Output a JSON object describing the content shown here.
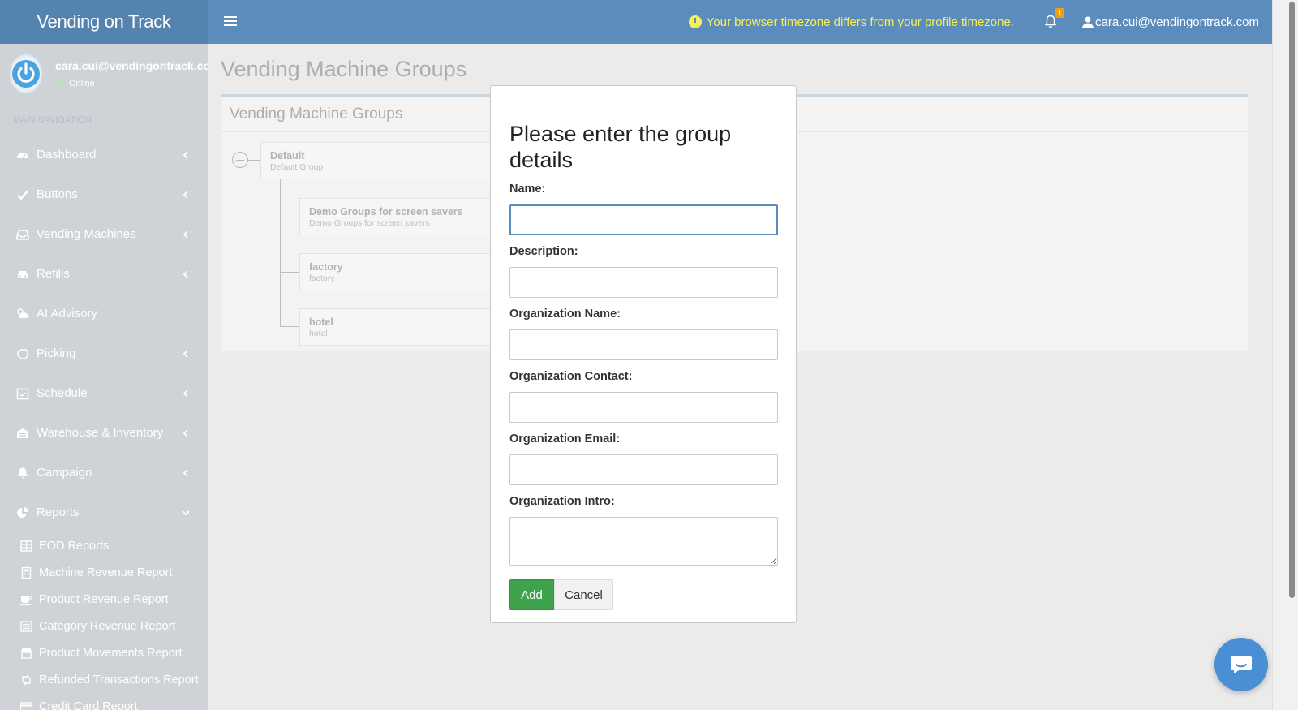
{
  "app": {
    "brand": "Vending on Track",
    "timezone_warning": "Your browser timezone differs from your profile timezone.",
    "notification_count": "1",
    "user_email": "cara.cui@vendingontrack.com"
  },
  "sidebar": {
    "user_email": "cara.cui@vendingontrack.com",
    "status": "Online",
    "nav_header": "MAIN NAVIGATION",
    "items": [
      {
        "label": "Dashboard",
        "icon": "dashboard-icon"
      },
      {
        "label": "Buttons",
        "icon": "check-icon"
      },
      {
        "label": "Vending Machines",
        "icon": "inbox-icon"
      },
      {
        "label": "Refills",
        "icon": "car-icon"
      },
      {
        "label": "AI Advisory",
        "icon": "cloud-sun-icon"
      },
      {
        "label": "Picking",
        "icon": "hand-icon"
      },
      {
        "label": "Schedule",
        "icon": "calendar-check-icon"
      },
      {
        "label": "Warehouse & Inventory",
        "icon": "warehouse-icon"
      },
      {
        "label": "Campaign",
        "icon": "bell-icon"
      },
      {
        "label": "Reports",
        "icon": "pie-chart-icon"
      }
    ],
    "reports_sub": [
      {
        "label": "EOD Reports",
        "icon": "table-icon"
      },
      {
        "label": "Machine Revenue Report",
        "icon": "calculator-icon"
      },
      {
        "label": "Product Revenue Report",
        "icon": "coffee-icon"
      },
      {
        "label": "Category Revenue Report",
        "icon": "list-icon"
      },
      {
        "label": "Product Movements Report",
        "icon": "store-icon"
      },
      {
        "label": "Refunded Transactions Report",
        "icon": "retweet-icon"
      },
      {
        "label": "Credit Card Report",
        "icon": "credit-card-icon"
      }
    ]
  },
  "main": {
    "page_title": "Vending Machine Groups",
    "box_title": "Vending Machine Groups",
    "tree": {
      "root": {
        "name": "Default",
        "desc": "Default Group"
      },
      "children": [
        {
          "name": "Demo Groups for screen savers",
          "desc": "Demo Groups for screen savers"
        },
        {
          "name": "factory",
          "desc": "factory"
        },
        {
          "name": "hotel",
          "desc": "hotel"
        }
      ]
    }
  },
  "modal": {
    "title": "Please enter the group details",
    "fields": [
      {
        "label": "Name:",
        "value": ""
      },
      {
        "label": "Description:",
        "value": ""
      },
      {
        "label": "Organization Name:",
        "value": ""
      },
      {
        "label": "Organization Contact:",
        "value": ""
      },
      {
        "label": "Organization Email:",
        "value": ""
      },
      {
        "label": "Organization Intro:",
        "value": ""
      }
    ],
    "add_label": "Add",
    "cancel_label": "Cancel"
  },
  "colors": {
    "topbar": "#5b8cbb",
    "warning": "#f6f05a",
    "add_button": "#3fa34d",
    "chat_button": "#4a8ed4"
  }
}
